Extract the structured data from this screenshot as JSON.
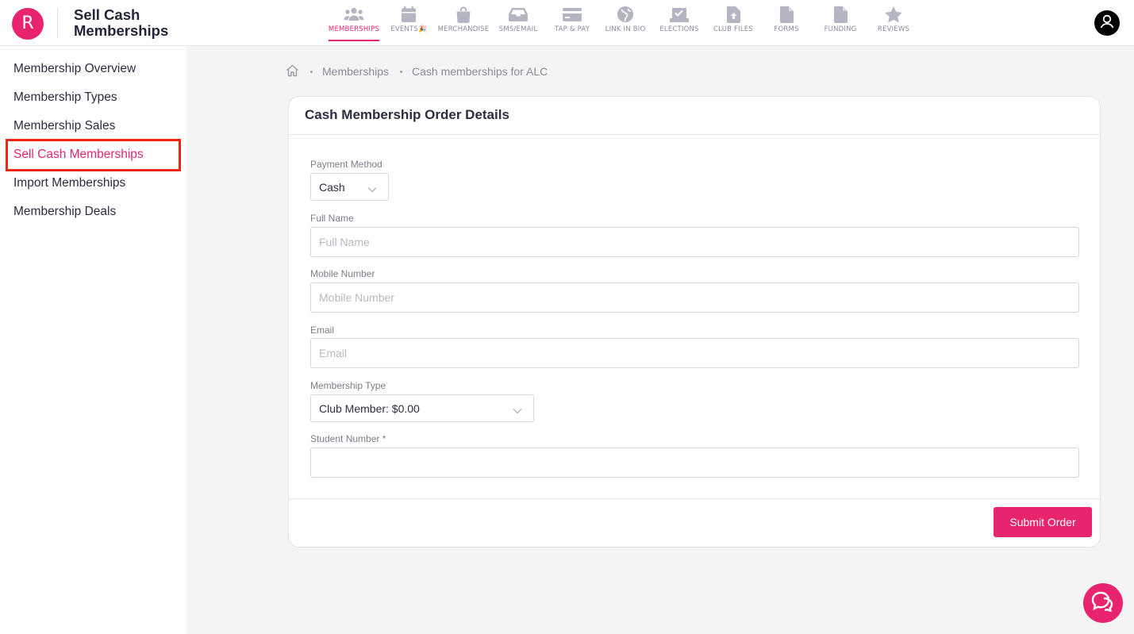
{
  "app": {
    "logo_letter": "R",
    "title": "Sell Cash Memberships",
    "brand_color": "#e8246f"
  },
  "nav": [
    {
      "label": "MEMBERSHIPS",
      "icon": "users-icon",
      "active": true
    },
    {
      "label": "EVENTS",
      "icon": "calendar-icon",
      "badge": "🎉"
    },
    {
      "label": "MERCHANDISE",
      "icon": "shopping-bag-icon"
    },
    {
      "label": "SMS/EMAIL",
      "icon": "inbox-icon"
    },
    {
      "label": "TAP & PAY",
      "icon": "credit-card-icon"
    },
    {
      "label": "LINK IN BIO",
      "icon": "globe-icon"
    },
    {
      "label": "ELECTIONS",
      "icon": "vote-icon"
    },
    {
      "label": "CLUB FILES",
      "icon": "file-upload-icon"
    },
    {
      "label": "FORMS",
      "icon": "form-icon"
    },
    {
      "label": "FUNDING",
      "icon": "funding-file-icon"
    },
    {
      "label": "REVIEWS",
      "icon": "star-icon"
    }
  ],
  "sidebar": {
    "items": [
      {
        "label": "Membership Overview"
      },
      {
        "label": "Membership Types"
      },
      {
        "label": "Membership Sales"
      },
      {
        "label": "Sell Cash Memberships",
        "active": true
      },
      {
        "label": "Import Memberships"
      },
      {
        "label": "Membership Deals"
      }
    ]
  },
  "breadcrumb": {
    "home_icon": "home-icon",
    "items": [
      "Memberships",
      "Cash memberships for ALC"
    ]
  },
  "form": {
    "title": "Cash Membership Order Details",
    "payment_method": {
      "label": "Payment Method",
      "value": "Cash"
    },
    "full_name": {
      "label": "Full Name",
      "placeholder": "Full Name",
      "value": ""
    },
    "mobile_number": {
      "label": "Mobile Number",
      "placeholder": "Mobile Number",
      "value": ""
    },
    "email": {
      "label": "Email",
      "placeholder": "Email",
      "value": ""
    },
    "membership_type": {
      "label": "Membership Type",
      "value": "Club Member: $0.00"
    },
    "student_number": {
      "label": "Student Number *",
      "placeholder": "",
      "value": ""
    },
    "submit_label": "Submit Order"
  }
}
